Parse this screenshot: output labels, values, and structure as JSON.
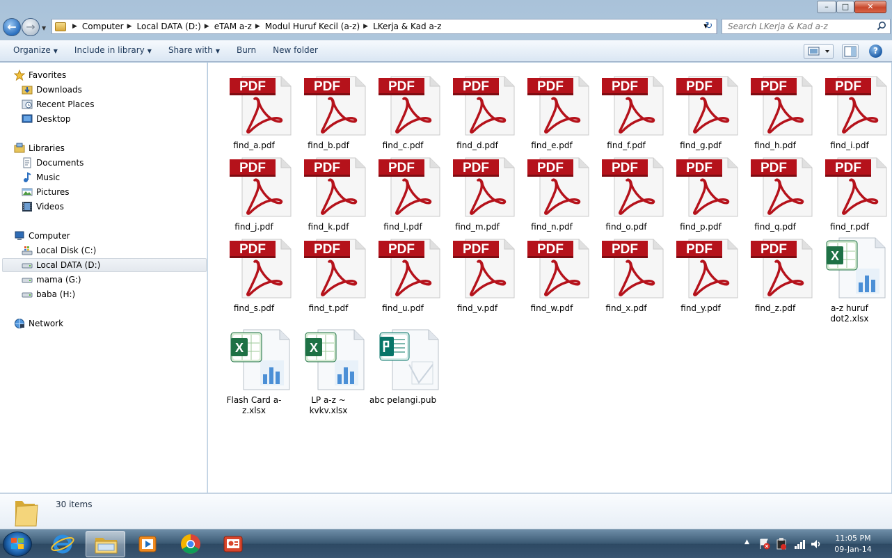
{
  "window": {
    "controls": {
      "minimize": "–",
      "maximize": "□",
      "close": "✕"
    }
  },
  "address": {
    "breadcrumbs": [
      "Computer",
      "Local DATA (D:)",
      "eTAM a-z",
      "Modul Huruf Kecil (a-z)",
      "LKerja & Kad a-z"
    ],
    "search_placeholder": "Search LKerja & Kad a-z"
  },
  "toolbar": {
    "organize": "Organize",
    "include_in_library": "Include in library",
    "share_with": "Share with",
    "burn": "Burn",
    "new_folder": "New folder",
    "help": "?"
  },
  "nav": {
    "favorites": "Favorites",
    "downloads": "Downloads",
    "recent_places": "Recent Places",
    "desktop": "Desktop",
    "libraries": "Libraries",
    "documents": "Documents",
    "music": "Music",
    "pictures": "Pictures",
    "videos": "Videos",
    "computer": "Computer",
    "local_disk_c": "Local Disk (C:)",
    "local_data_d": "Local DATA (D:)",
    "mama_g": "mama (G:)",
    "baba_h": "baba (H:)",
    "network": "Network"
  },
  "files": [
    {
      "name": "find_a.pdf",
      "type": "pdf"
    },
    {
      "name": "find_b.pdf",
      "type": "pdf"
    },
    {
      "name": "find_c.pdf",
      "type": "pdf"
    },
    {
      "name": "find_d.pdf",
      "type": "pdf"
    },
    {
      "name": "find_e.pdf",
      "type": "pdf"
    },
    {
      "name": "find_f.pdf",
      "type": "pdf"
    },
    {
      "name": "find_g.pdf",
      "type": "pdf"
    },
    {
      "name": "find_h.pdf",
      "type": "pdf"
    },
    {
      "name": "find_i.pdf",
      "type": "pdf"
    },
    {
      "name": "find_j.pdf",
      "type": "pdf"
    },
    {
      "name": "find_k.pdf",
      "type": "pdf"
    },
    {
      "name": "find_l.pdf",
      "type": "pdf"
    },
    {
      "name": "find_m.pdf",
      "type": "pdf"
    },
    {
      "name": "find_n.pdf",
      "type": "pdf"
    },
    {
      "name": "find_o.pdf",
      "type": "pdf"
    },
    {
      "name": "find_p.pdf",
      "type": "pdf"
    },
    {
      "name": "find_q.pdf",
      "type": "pdf"
    },
    {
      "name": "find_r.pdf",
      "type": "pdf"
    },
    {
      "name": "find_s.pdf",
      "type": "pdf"
    },
    {
      "name": "find_t.pdf",
      "type": "pdf"
    },
    {
      "name": "find_u.pdf",
      "type": "pdf"
    },
    {
      "name": "find_v.pdf",
      "type": "pdf"
    },
    {
      "name": "find_w.pdf",
      "type": "pdf"
    },
    {
      "name": "find_x.pdf",
      "type": "pdf"
    },
    {
      "name": "find_y.pdf",
      "type": "pdf"
    },
    {
      "name": "find_z.pdf",
      "type": "pdf"
    },
    {
      "name": "a-z huruf dot2.xlsx",
      "type": "xlsx"
    },
    {
      "name": "Flash Card a-z.xlsx",
      "type": "xlsx"
    },
    {
      "name": "LP a-z ~ kvkv.xlsx",
      "type": "xlsx"
    },
    {
      "name": "abc pelangi.pub",
      "type": "pub"
    }
  ],
  "pdf_badge": "PDF",
  "status": {
    "item_count": "30 items"
  },
  "clock": {
    "time": "11:05 PM",
    "date": "09-Jan-14"
  },
  "colors": {
    "pdf_red": "#b5121b",
    "excel_green": "#1e7145",
    "publisher_teal": "#077568",
    "accent": "#1e395b"
  }
}
